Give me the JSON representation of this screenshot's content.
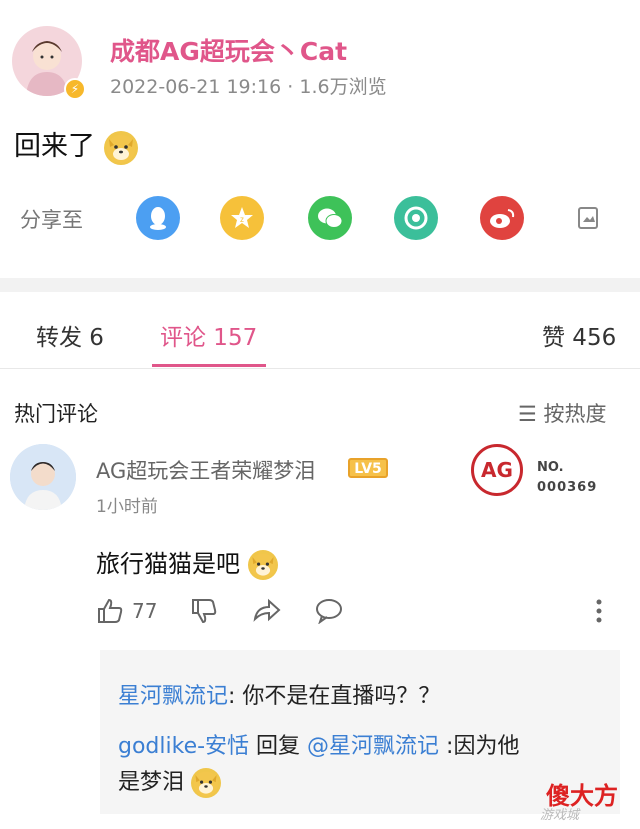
{
  "post": {
    "username": "成都AG超玩会丶Cat",
    "timestamp": "2022-06-21 19:16",
    "views": "1.6万浏览",
    "text": "回来了"
  },
  "share": {
    "label": "分享至",
    "targets": [
      {
        "name": "qq-icon",
        "color": "#4c9ff2"
      },
      {
        "name": "qzone-icon",
        "color": "#f6c13a"
      },
      {
        "name": "wechat-icon",
        "color": "#3ec259"
      },
      {
        "name": "moments-icon",
        "color": "#3bbf9a"
      },
      {
        "name": "weibo-icon",
        "color": "#e0433f"
      },
      {
        "name": "poster-icon",
        "color": "#888888"
      }
    ]
  },
  "tabs": {
    "repost": "转发 6",
    "comments": "评论 157",
    "likes": "赞 456"
  },
  "comments": {
    "section_title": "热门评论",
    "sort_label": "按热度",
    "items": [
      {
        "name": "AG超玩会王者荣耀梦泪",
        "level": "LV5",
        "time": "1小时前",
        "badge_no": "NO.",
        "badge_num": "000369",
        "badge_logo": "AG",
        "text": "旅行猫猫是吧",
        "like_count": "77",
        "replies": [
          {
            "author": "星河飘流记",
            "text": ": 你不是在直播吗？？"
          },
          {
            "author": "godlike-安恬",
            "reply_word": " 回复 ",
            "mention": "@星河飘流记",
            "text": " :因为他",
            "text_cont": "是梦泪"
          }
        ]
      }
    ]
  },
  "watermark": {
    "main": "傻大方",
    "sub": "游戏城"
  },
  "colors": {
    "accent": "#e0568a",
    "link": "#3b7fd3",
    "level_badge": "#f6c14a",
    "ag_red": "#c8282e"
  }
}
